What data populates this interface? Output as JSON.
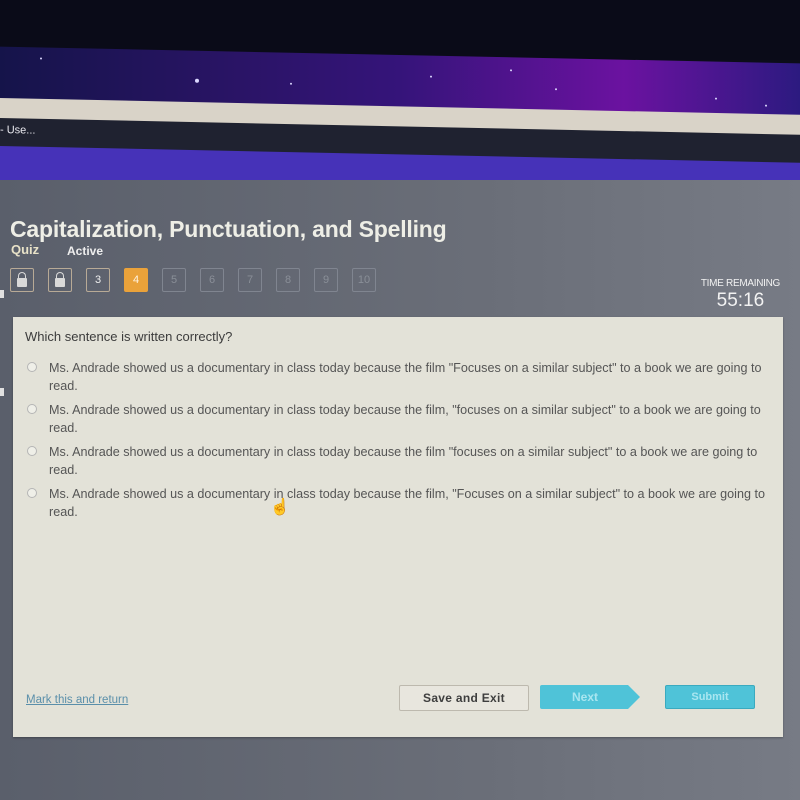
{
  "taskbar": {
    "window_title": "- Use..."
  },
  "quiz": {
    "title": "Capitalization, Punctuation, and Spelling",
    "type": "Quiz",
    "status": "Active"
  },
  "question_nav": [
    {
      "label": "",
      "state": "locked",
      "icon": "lock-icon"
    },
    {
      "label": "",
      "state": "locked",
      "icon": "lock-icon"
    },
    {
      "label": "3",
      "state": "answered"
    },
    {
      "label": "4",
      "state": "current"
    },
    {
      "label": "5",
      "state": "future"
    },
    {
      "label": "6",
      "state": "future"
    },
    {
      "label": "7",
      "state": "future"
    },
    {
      "label": "8",
      "state": "future"
    },
    {
      "label": "9",
      "state": "future"
    },
    {
      "label": "10",
      "state": "future"
    }
  ],
  "timer": {
    "label": "TIME REMAINING",
    "value": "55:16"
  },
  "question": {
    "prompt": "Which sentence is written correctly?",
    "options": [
      {
        "text": "Ms. Andrade showed us a documentary in class today because the film \"Focuses on a similar subject\" to a book we are going to read."
      },
      {
        "text": "Ms. Andrade showed us a documentary in class today because the film, \"focuses on a similar subject\" to a book we are going to read."
      },
      {
        "text": "Ms. Andrade showed us a documentary in class today because the film \"focuses on a similar subject\" to a book we are going to read."
      },
      {
        "text": "Ms. Andrade showed us a documentary in class today because the film, \"Focuses on a similar subject\" to a book we are going to read."
      }
    ]
  },
  "footer": {
    "mark_link": "Mark this and return",
    "save_label": "Save and Exit",
    "next_label": "Next",
    "submit_label": "Submit"
  },
  "colors": {
    "accent_current": "#eaa23a",
    "button_primary": "#4fc3d8",
    "header_band": "#4632b8"
  }
}
